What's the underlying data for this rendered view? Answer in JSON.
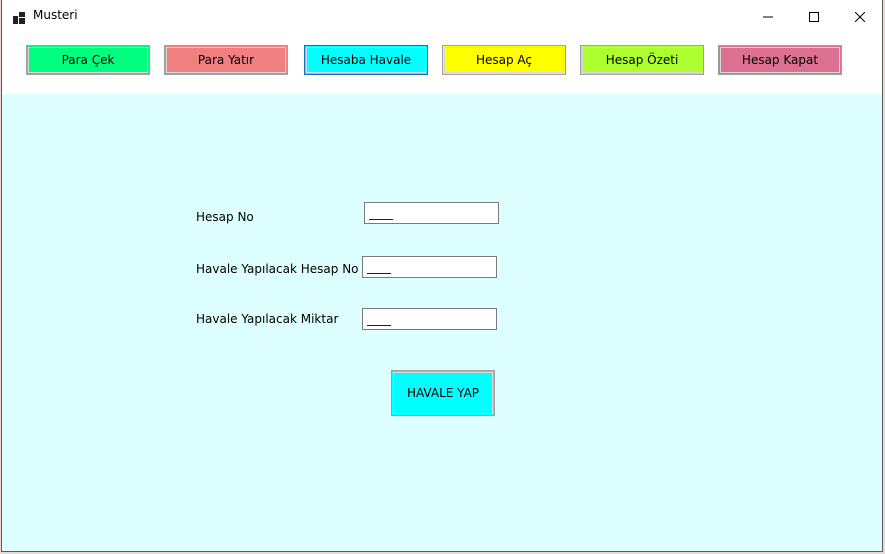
{
  "window": {
    "title": "Musteri",
    "app_icon": "form-app-icon",
    "controls": {
      "minimize_icon": "minimize-icon",
      "maximize_icon": "maximize-icon",
      "close_icon": "close-icon"
    }
  },
  "nav": {
    "buttons": [
      {
        "label": "Para Çek",
        "color": "#00ff7f"
      },
      {
        "label": "Para Yatır",
        "color": "#f08080"
      },
      {
        "label": "Hesaba Havale",
        "color": "#00ffff",
        "active": true
      },
      {
        "label": "Hesap Aç",
        "color": "#ffff00"
      },
      {
        "label": "Hesap Özeti",
        "color": "#adff2f"
      },
      {
        "label": "Hesap Kapat",
        "color": "#db7093"
      }
    ]
  },
  "form": {
    "account_no": {
      "label": "Hesap No",
      "value": "____"
    },
    "target_account_no": {
      "label": "Havale Yapılacak Hesap No",
      "value": "____"
    },
    "amount": {
      "label": "Havale Yapılacak Miktar",
      "value": "____"
    },
    "submit_label": "HAVALE YAP",
    "submit_color": "#00ffff"
  },
  "colors": {
    "content_background": "#deffff",
    "toolbar_background": "#ffffff"
  }
}
